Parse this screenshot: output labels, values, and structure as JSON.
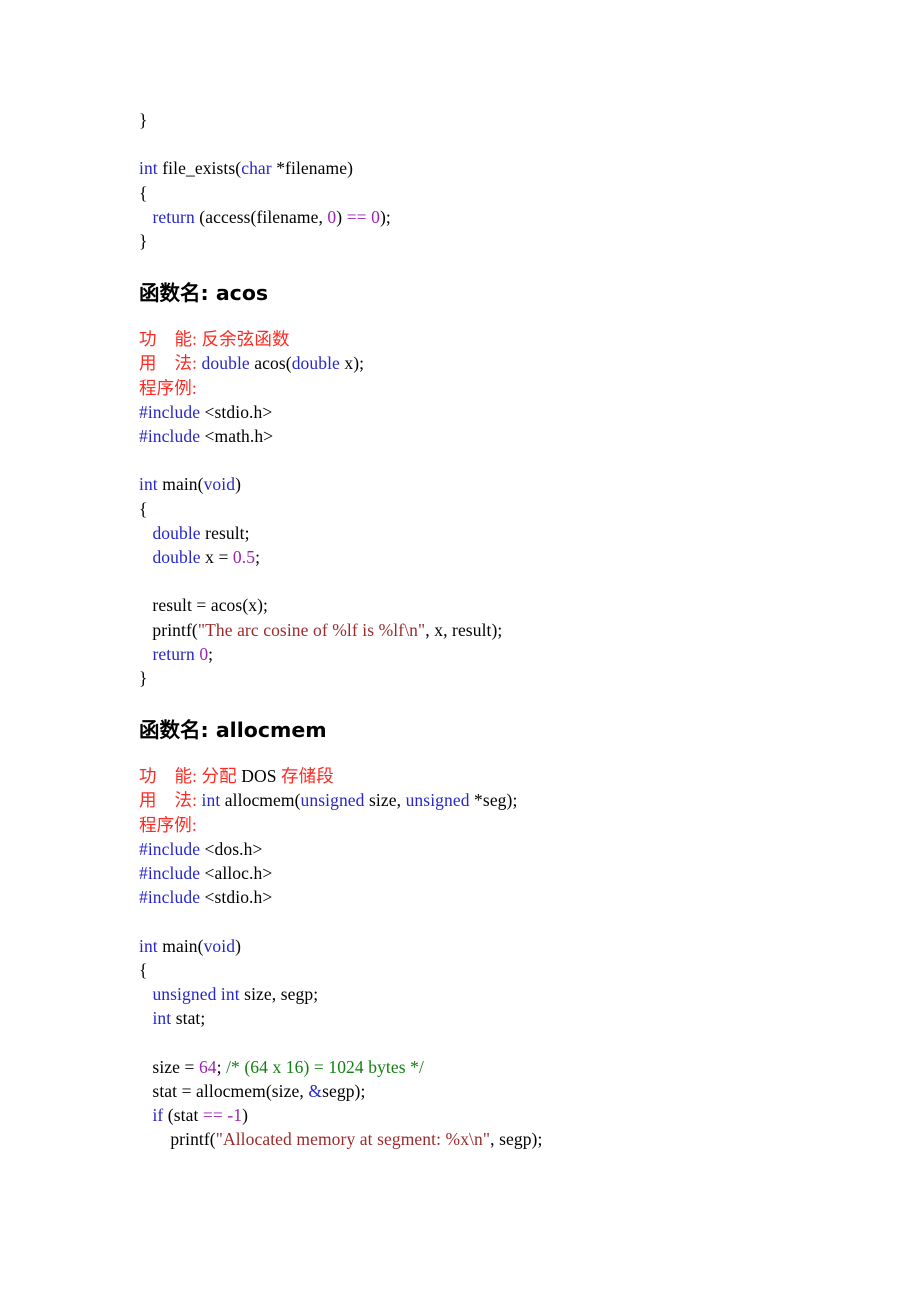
{
  "document": {
    "kind": "c-function-reference-page",
    "background_color": "#ffffff",
    "colors": {
      "keyword_blue": "#2626CC",
      "number_purple": "#9B22B0",
      "string_darkred": "#9B2A2A",
      "comment_green": "#128012",
      "label_red": "#FC2A22",
      "text_black": "#000000"
    }
  },
  "top_code": {
    "lines": [
      {
        "id": "l1",
        "tokens": [
          {
            "t": "}",
            "c": "blk"
          }
        ]
      },
      {
        "id": "l2",
        "tokens": []
      },
      {
        "id": "l3",
        "tokens": [
          {
            "t": "int",
            "c": "kw"
          },
          {
            "t": " file_exists(",
            "c": "blk"
          },
          {
            "t": "char",
            "c": "kw"
          },
          {
            "t": " *filename)",
            "c": "blk"
          }
        ]
      },
      {
        "id": "l4",
        "tokens": [
          {
            "t": "{",
            "c": "blk"
          }
        ]
      },
      {
        "id": "l5",
        "tokens": [
          {
            "t": "   ",
            "c": "blk"
          },
          {
            "t": "return",
            "c": "kw"
          },
          {
            "t": " (access(filename, ",
            "c": "blk"
          },
          {
            "t": "0",
            "c": "num"
          },
          {
            "t": ") ",
            "c": "blk"
          },
          {
            "t": "==",
            "c": "num"
          },
          {
            "t": " ",
            "c": "blk"
          },
          {
            "t": "0",
            "c": "num"
          },
          {
            "t": ");",
            "c": "blk"
          }
        ]
      },
      {
        "id": "l6",
        "tokens": [
          {
            "t": "}",
            "c": "blk"
          }
        ]
      }
    ]
  },
  "sections": [
    {
      "id": "acos",
      "heading_label": "函数名",
      "heading_sep": ": ",
      "heading_name": "acos",
      "desc": [
        {
          "id": "d1",
          "tokens": [
            {
              "t": "功    能",
              "c": "lbl"
            },
            {
              "t": ": ",
              "c": "lbl"
            },
            {
              "t": "反余弦函数",
              "c": "lbl"
            }
          ]
        },
        {
          "id": "d2",
          "tokens": [
            {
              "t": "用    法",
              "c": "lbl"
            },
            {
              "t": ": ",
              "c": "lbl"
            },
            {
              "t": "double",
              "c": "kw"
            },
            {
              "t": " acos(",
              "c": "blk"
            },
            {
              "t": "double",
              "c": "kw"
            },
            {
              "t": " x);",
              "c": "blk"
            }
          ]
        },
        {
          "id": "d3",
          "tokens": [
            {
              "t": "程序例",
              "c": "lbl"
            },
            {
              "t": ":",
              "c": "lbl"
            }
          ]
        }
      ],
      "code": [
        {
          "id": "c1",
          "tokens": [
            {
              "t": "#include",
              "c": "kw"
            },
            {
              "t": " <stdio.h>",
              "c": "blk"
            }
          ]
        },
        {
          "id": "c2",
          "tokens": [
            {
              "t": "#include",
              "c": "kw"
            },
            {
              "t": " <math.h>",
              "c": "blk"
            }
          ]
        },
        {
          "id": "c3",
          "tokens": []
        },
        {
          "id": "c4",
          "tokens": [
            {
              "t": "int",
              "c": "kw"
            },
            {
              "t": " main(",
              "c": "blk"
            },
            {
              "t": "void",
              "c": "kw"
            },
            {
              "t": ")",
              "c": "blk"
            }
          ]
        },
        {
          "id": "c5",
          "tokens": [
            {
              "t": "{",
              "c": "blk"
            }
          ]
        },
        {
          "id": "c6",
          "tokens": [
            {
              "t": "   ",
              "c": "blk"
            },
            {
              "t": "double",
              "c": "kw"
            },
            {
              "t": " result;",
              "c": "blk"
            }
          ]
        },
        {
          "id": "c7",
          "tokens": [
            {
              "t": "   ",
              "c": "blk"
            },
            {
              "t": "double",
              "c": "kw"
            },
            {
              "t": " x = ",
              "c": "blk"
            },
            {
              "t": "0.5",
              "c": "num"
            },
            {
              "t": ";",
              "c": "blk"
            }
          ]
        },
        {
          "id": "c8",
          "tokens": []
        },
        {
          "id": "c9",
          "tokens": [
            {
              "t": "   result = acos(x);",
              "c": "blk"
            }
          ]
        },
        {
          "id": "c10",
          "tokens": [
            {
              "t": "   printf(",
              "c": "blk"
            },
            {
              "t": "\"The arc cosine of %lf is %lf\\n\"",
              "c": "str"
            },
            {
              "t": ", x, result);",
              "c": "blk"
            }
          ]
        },
        {
          "id": "c11",
          "tokens": [
            {
              "t": "   ",
              "c": "blk"
            },
            {
              "t": "return",
              "c": "kw"
            },
            {
              "t": " ",
              "c": "blk"
            },
            {
              "t": "0",
              "c": "num"
            },
            {
              "t": ";",
              "c": "blk"
            }
          ]
        },
        {
          "id": "c12",
          "tokens": [
            {
              "t": "}",
              "c": "blk"
            }
          ]
        }
      ]
    },
    {
      "id": "allocmem",
      "heading_label": "函数名",
      "heading_sep": ": ",
      "heading_name": "allocmem",
      "desc": [
        {
          "id": "d1",
          "tokens": [
            {
              "t": "功    能",
              "c": "lbl"
            },
            {
              "t": ": ",
              "c": "lbl"
            },
            {
              "t": "分配",
              "c": "lbl"
            },
            {
              "t": " DOS ",
              "c": "blk"
            },
            {
              "t": "存储段",
              "c": "lbl"
            }
          ]
        },
        {
          "id": "d2",
          "tokens": [
            {
              "t": "用    法",
              "c": "lbl"
            },
            {
              "t": ": ",
              "c": "lbl"
            },
            {
              "t": "int",
              "c": "kw"
            },
            {
              "t": " allocmem(",
              "c": "blk"
            },
            {
              "t": "unsigned",
              "c": "kw"
            },
            {
              "t": " size, ",
              "c": "blk"
            },
            {
              "t": "unsigned",
              "c": "kw"
            },
            {
              "t": " *seg);",
              "c": "blk"
            }
          ]
        },
        {
          "id": "d3",
          "tokens": [
            {
              "t": "程序例",
              "c": "lbl"
            },
            {
              "t": ":",
              "c": "lbl"
            }
          ]
        }
      ],
      "code": [
        {
          "id": "c1",
          "tokens": [
            {
              "t": "#include",
              "c": "kw"
            },
            {
              "t": " <dos.h>",
              "c": "blk"
            }
          ]
        },
        {
          "id": "c2",
          "tokens": [
            {
              "t": "#include",
              "c": "kw"
            },
            {
              "t": " <alloc.h>",
              "c": "blk"
            }
          ]
        },
        {
          "id": "c3",
          "tokens": [
            {
              "t": "#include",
              "c": "kw"
            },
            {
              "t": " <stdio.h>",
              "c": "blk"
            }
          ]
        },
        {
          "id": "c4",
          "tokens": []
        },
        {
          "id": "c5",
          "tokens": [
            {
              "t": "int",
              "c": "kw"
            },
            {
              "t": " main(",
              "c": "blk"
            },
            {
              "t": "void",
              "c": "kw"
            },
            {
              "t": ")",
              "c": "blk"
            }
          ]
        },
        {
          "id": "c6",
          "tokens": [
            {
              "t": "{",
              "c": "blk"
            }
          ]
        },
        {
          "id": "c7",
          "tokens": [
            {
              "t": "   ",
              "c": "blk"
            },
            {
              "t": "unsigned int",
              "c": "kw"
            },
            {
              "t": " size, segp;",
              "c": "blk"
            }
          ]
        },
        {
          "id": "c8",
          "tokens": [
            {
              "t": "   ",
              "c": "blk"
            },
            {
              "t": "int",
              "c": "kw"
            },
            {
              "t": " stat;",
              "c": "blk"
            }
          ]
        },
        {
          "id": "c9",
          "tokens": []
        },
        {
          "id": "c10",
          "tokens": [
            {
              "t": "   size = ",
              "c": "blk"
            },
            {
              "t": "64",
              "c": "num"
            },
            {
              "t": "; ",
              "c": "blk"
            },
            {
              "t": "/* (64 x 16) = 1024 bytes */",
              "c": "cmt"
            }
          ]
        },
        {
          "id": "c11",
          "tokens": [
            {
              "t": "   stat = allocmem(size, ",
              "c": "blk"
            },
            {
              "t": "&",
              "c": "kw"
            },
            {
              "t": "segp);",
              "c": "blk"
            }
          ]
        },
        {
          "id": "c12",
          "tokens": [
            {
              "t": "   ",
              "c": "blk"
            },
            {
              "t": "if",
              "c": "kw"
            },
            {
              "t": " (stat ",
              "c": "blk"
            },
            {
              "t": "==",
              "c": "num"
            },
            {
              "t": " ",
              "c": "blk"
            },
            {
              "t": "-1",
              "c": "num"
            },
            {
              "t": ")",
              "c": "blk"
            }
          ]
        },
        {
          "id": "c13",
          "tokens": [
            {
              "t": "       printf(",
              "c": "blk"
            },
            {
              "t": "\"Allocated memory at segment: %x\\n\"",
              "c": "str"
            },
            {
              "t": ", segp);",
              "c": "blk"
            }
          ]
        }
      ]
    }
  ]
}
